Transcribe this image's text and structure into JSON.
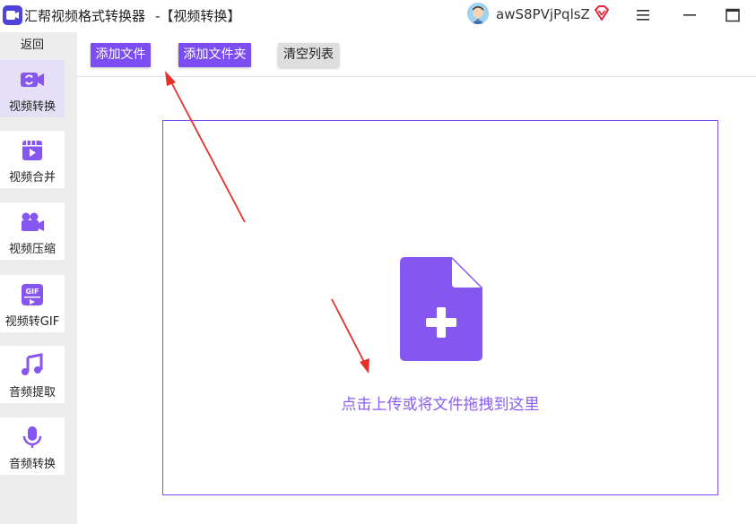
{
  "window": {
    "app_title": "汇帮视频格式转换器",
    "page_subtitle": "-【视频转换】",
    "username": "awS8PVjPqlsZ",
    "icons": {
      "logo": "app-logo-icon",
      "avatar": "user-avatar",
      "vip": "vip-diamond-icon",
      "menu": "hamburger-menu-icon",
      "minimize": "minimize-icon",
      "maximize": "maximize-icon"
    }
  },
  "sidebar": {
    "back_label": "返回",
    "items": [
      {
        "label": "视频转换",
        "icon": "video-convert-icon",
        "active": true
      },
      {
        "label": "视频合并",
        "icon": "video-merge-icon",
        "active": false
      },
      {
        "label": "视频压缩",
        "icon": "video-compress-icon",
        "active": false
      },
      {
        "label": "视频转GIF",
        "icon": "gif-icon",
        "active": false
      },
      {
        "label": "音频提取",
        "icon": "music-note-icon",
        "active": false
      },
      {
        "label": "音频转换",
        "icon": "microphone-icon",
        "active": false
      }
    ]
  },
  "toolbar": {
    "add_file_label": "添加文件",
    "add_folder_label": "添加文件夹",
    "clear_list_label": "清空列表"
  },
  "dropzone": {
    "hint": "点击上传或将文件拖拽到这里",
    "icon": "file-add-icon"
  },
  "colors": {
    "accent": "#7c4ef2",
    "accent_text": "#8a5cf2",
    "sidebar_bg": "#ededed",
    "active_item_bg": "#e5dff8",
    "annotation_arrow": "#e8302a"
  }
}
